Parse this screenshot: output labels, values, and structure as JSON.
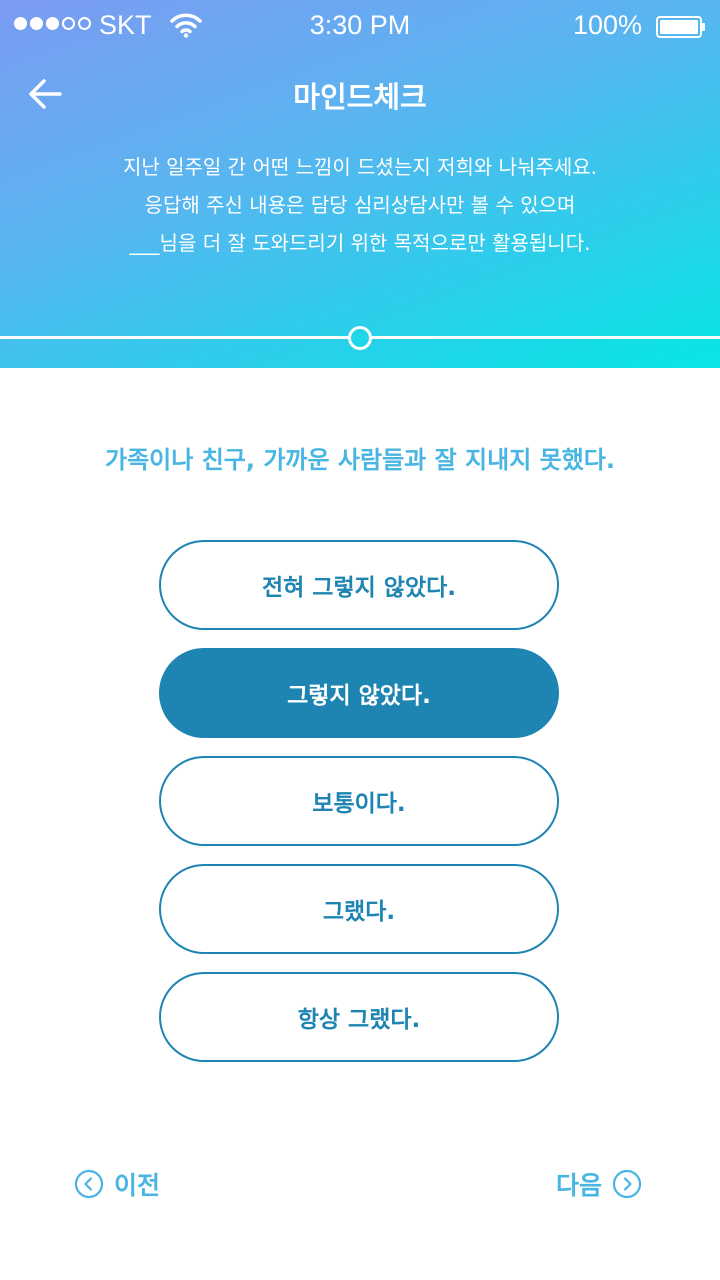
{
  "status_bar": {
    "carrier": "SKT",
    "time": "3:30 PM",
    "battery": "100%",
    "signal_bars_filled": 3,
    "signal_bars_total": 5
  },
  "header": {
    "title": "마인드체크",
    "intro_lines": [
      "지난 일주일 간 어떤 느낌이 드셨는지 저희와 나눠주세요.",
      "응답해 주신 내용은 담당 심리상담사만 볼 수 있으며",
      "___님을 더 잘 도와드리기 위한 목적으로만 활용됩니다."
    ],
    "progress": 0.5
  },
  "question": "가족이나 친구, 가까운 사람들과 잘 지내지 못했다.",
  "options": [
    {
      "label": "전혀 그렇지 않았다.",
      "selected": false
    },
    {
      "label": "그렇지 않았다.",
      "selected": true
    },
    {
      "label": "보통이다.",
      "selected": false
    },
    {
      "label": "그랬다.",
      "selected": false
    },
    {
      "label": "항상 그랬다.",
      "selected": false
    }
  ],
  "nav": {
    "prev_label": "이전",
    "next_label": "다음"
  },
  "colors": {
    "accent": "#1e84b2",
    "question_text": "#48b5e2",
    "header_gradient_start": "#7c9bf2",
    "header_gradient_end": "#07e6e6"
  },
  "icons": {
    "back": "arrow-left-icon",
    "prev": "chevron-left-circle-icon",
    "next": "chevron-right-circle-icon",
    "wifi": "wifi-icon",
    "battery": "battery-icon"
  }
}
